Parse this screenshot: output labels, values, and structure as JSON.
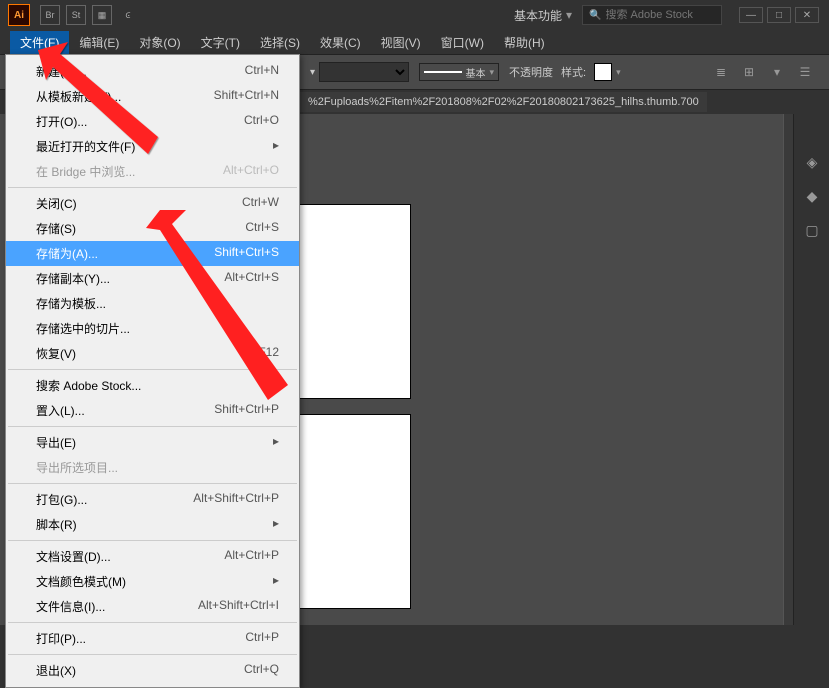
{
  "titlebar": {
    "app": "Ai",
    "icons": [
      "Br",
      "St"
    ],
    "workspace": "基本功能",
    "search_placeholder": "搜索 Adobe Stock"
  },
  "menubar": {
    "items": [
      {
        "label": "文件(F)",
        "open": true
      },
      {
        "label": "编辑(E)"
      },
      {
        "label": "对象(O)"
      },
      {
        "label": "文字(T)"
      },
      {
        "label": "选择(S)"
      },
      {
        "label": "效果(C)"
      },
      {
        "label": "视图(V)"
      },
      {
        "label": "窗口(W)"
      },
      {
        "label": "帮助(H)"
      }
    ]
  },
  "controlbar": {
    "stroke_style": "基本",
    "opacity_label": "不透明度",
    "style_label": "样式:"
  },
  "tabbar": {
    "doc": "%2Fuploads%2Fitem%2F201808%2F02%2F20180802173625_hilhs.thumb.700"
  },
  "file_menu": [
    {
      "label": "新建(N)...",
      "shortcut": "Ctrl+N"
    },
    {
      "label": "从模板新建(T)...",
      "shortcut": "Shift+Ctrl+N"
    },
    {
      "label": "打开(O)...",
      "shortcut": "Ctrl+O"
    },
    {
      "label": "最近打开的文件(F)",
      "submenu": true
    },
    {
      "label": "在 Bridge 中浏览...",
      "shortcut": "Alt+Ctrl+O",
      "disabled": true
    },
    {
      "sep": true
    },
    {
      "label": "关闭(C)",
      "shortcut": "Ctrl+W"
    },
    {
      "label": "存储(S)",
      "shortcut": "Ctrl+S"
    },
    {
      "label": "存储为(A)...",
      "shortcut": "Shift+Ctrl+S",
      "highlighted": true
    },
    {
      "label": "存储副本(Y)...",
      "shortcut": "Alt+Ctrl+S"
    },
    {
      "label": "存储为模板...",
      "shortcut": ""
    },
    {
      "label": "存储选中的切片...",
      "shortcut": ""
    },
    {
      "label": "恢复(V)",
      "shortcut": "F12"
    },
    {
      "sep": true
    },
    {
      "label": "搜索 Adobe Stock...",
      "shortcut": ""
    },
    {
      "label": "置入(L)...",
      "shortcut": "Shift+Ctrl+P"
    },
    {
      "sep": true
    },
    {
      "label": "导出(E)",
      "submenu": true
    },
    {
      "label": "导出所选项目...",
      "disabled": true
    },
    {
      "sep": true
    },
    {
      "label": "打包(G)...",
      "shortcut": "Alt+Shift+Ctrl+P"
    },
    {
      "label": "脚本(R)",
      "submenu": true
    },
    {
      "sep": true
    },
    {
      "label": "文档设置(D)...",
      "shortcut": "Alt+Ctrl+P"
    },
    {
      "label": "文档颜色模式(M)",
      "submenu": true
    },
    {
      "label": "文件信息(I)...",
      "shortcut": "Alt+Shift+Ctrl+I"
    },
    {
      "sep": true
    },
    {
      "label": "打印(P)...",
      "shortcut": "Ctrl+P"
    },
    {
      "sep": true
    },
    {
      "label": "退出(X)",
      "shortcut": "Ctrl+Q"
    }
  ]
}
